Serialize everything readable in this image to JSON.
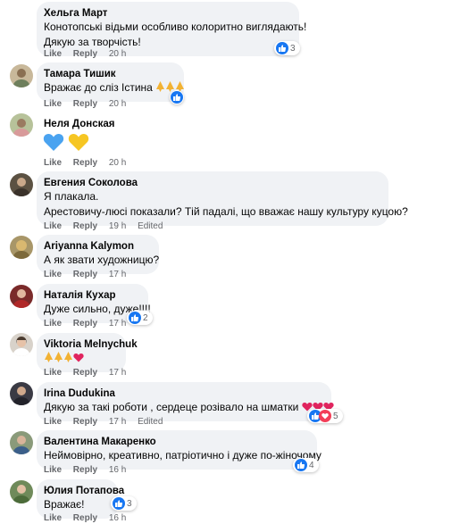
{
  "labels": {
    "like": "Like",
    "reply": "Reply",
    "edited": "Edited"
  },
  "comments": [
    {
      "author": "Хельга Март",
      "lines": [
        "Конотопські відьми особливо колоритно виглядають!",
        "Дякую за творчість!"
      ],
      "time": "20 h",
      "reactions": "3"
    },
    {
      "author": "Тамара Тишик",
      "lines": [
        "Вражає до сліз Істина"
      ],
      "time": "20 h",
      "reactions": ""
    },
    {
      "author": "Неля Донская",
      "lines": [],
      "time": "20 h",
      "reactions": ""
    },
    {
      "author": "Евгения Соколова",
      "lines": [
        "Я плакала.",
        "Арестовичу-люсі показали? Тій падалі, що вважає нашу культуру куцою?"
      ],
      "time": "19 h",
      "reactions": ""
    },
    {
      "author": "Ariyanna Kalymon",
      "lines": [
        "А як звати художницю?"
      ],
      "time": "17 h",
      "reactions": ""
    },
    {
      "author": "Наталія Кухар",
      "lines": [
        "Дуже сильно, дуже!!!!"
      ],
      "time": "17 h",
      "reactions": "2"
    },
    {
      "author": "Viktoria Melnychuk",
      "lines": [],
      "time": "17 h",
      "reactions": ""
    },
    {
      "author": "Irina Dudukina",
      "lines": [
        "Дякую за такі роботи , сердеце розівало на шматки"
      ],
      "time": "17 h",
      "reactions": "5"
    },
    {
      "author": "Валентина Макаренко",
      "lines": [
        "Неймовірно, креативно, патріотично і дуже по-жіночому"
      ],
      "time": "16 h",
      "reactions": "4"
    },
    {
      "author": "Юлия Потапова",
      "lines": [
        "Вражає!"
      ],
      "time": "16 h",
      "reactions": "3"
    }
  ],
  "colors": {
    "bubble": "#f0f2f5",
    "meta": "#65676b",
    "like": "#1877f2",
    "love": "#f33e58"
  }
}
